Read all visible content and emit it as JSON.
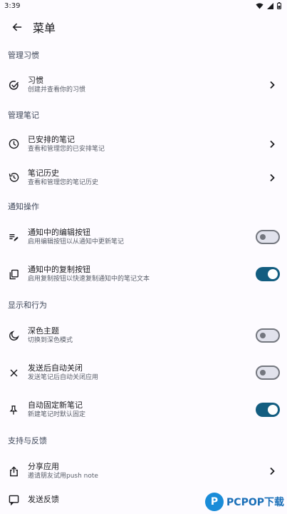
{
  "status_bar": {
    "time": "3:39"
  },
  "app_bar": {
    "title": "菜单"
  },
  "sections": {
    "habits": {
      "header": "管理习惯",
      "habit": {
        "title": "习惯",
        "subtitle": "创建并查看你的习惯"
      }
    },
    "notes": {
      "header": "管理笔记",
      "scheduled": {
        "title": "已安排的笔记",
        "subtitle": "查看和管理您的已安排笔记"
      },
      "history": {
        "title": "笔记历史",
        "subtitle": "查看和管理您的笔记历史"
      }
    },
    "notification": {
      "header": "通知操作",
      "edit_button": {
        "title": "通知中的编辑按钮",
        "subtitle": "启用编辑按钮以从通知中更新笔记",
        "enabled": false
      },
      "copy_button": {
        "title": "通知中的复制按钮",
        "subtitle": "启用复制按钮以快速复制通知中的笔记文本",
        "enabled": true
      }
    },
    "display": {
      "header": "显示和行为",
      "dark_theme": {
        "title": "深色主题",
        "subtitle": "切换到深色模式",
        "enabled": false
      },
      "auto_close": {
        "title": "发送后自动关闭",
        "subtitle": "发送笔记后自动关闭应用",
        "enabled": false
      },
      "auto_pin": {
        "title": "自动固定新笔记",
        "subtitle": "新建笔记时默认固定",
        "enabled": true
      }
    },
    "support": {
      "header": "支持与反馈",
      "share": {
        "title": "分享应用",
        "subtitle": "邀请朋友试用push note"
      },
      "feedback": {
        "title": "发送反馈"
      }
    }
  },
  "watermark": {
    "logo": "P",
    "text": "PCPOP下载"
  },
  "colors": {
    "accent": "#135d80",
    "background": "#fdfbff"
  }
}
